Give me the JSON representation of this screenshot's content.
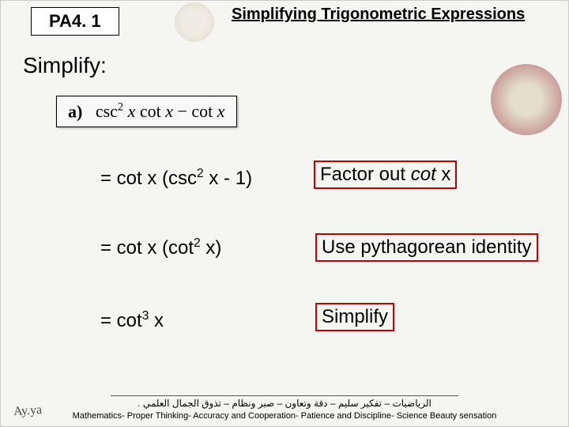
{
  "header": {
    "code": "PA4. 1",
    "title": "Simplifying Trigonometric Expressions"
  },
  "prompt": "Simplify:",
  "problem": {
    "label": "a)",
    "expr_html": "csc<span class='sup'>2</span> <i>x</i> cot <i>x</i> − cot <i>x</i>"
  },
  "steps": {
    "s1": {
      "expr_html": "= cot x (csc<span class='sup'>2</span> x - 1)",
      "hint_html": "Factor out <span class='italic'>cot</span> x"
    },
    "s2": {
      "expr_html": "= cot x (cot<span class='sup'>2</span> x)",
      "hint": "Use pythagorean identity"
    },
    "s3": {
      "expr_html": "= cot<span class='sup'>3</span> x",
      "hint": "Simplify"
    }
  },
  "footer": {
    "arabic": "الرياضيات – تفكير سليم – دقة وتعاون – صبر ونظام – تذوق الجمال العلمي .",
    "english": "Mathematics- Proper Thinking- Accuracy and Cooperation- Patience and Discipline- Science Beauty sensation"
  },
  "signature": "Ay.ya"
}
